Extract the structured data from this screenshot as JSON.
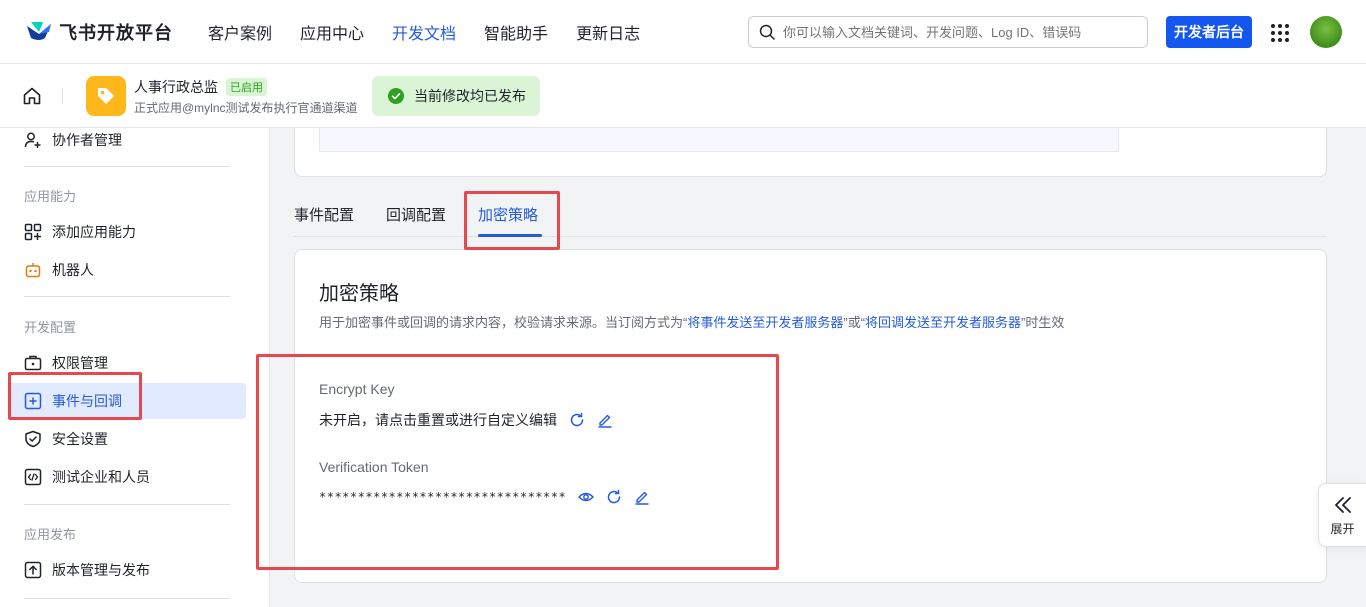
{
  "topnav": {
    "logo_text": "飞书开放平台",
    "items": [
      {
        "label": "客户案例",
        "active": false
      },
      {
        "label": "应用中心",
        "active": false
      },
      {
        "label": "开发文档",
        "active": true
      },
      {
        "label": "智能助手",
        "active": false
      },
      {
        "label": "更新日志",
        "active": false
      }
    ],
    "search_placeholder": "你可以输入文档关键词、开发问题、Log ID、错误码",
    "dev_console_label": "开发者后台"
  },
  "appbar": {
    "app_name": "人事行政总监",
    "app_status": "已启用",
    "app_subtitle": "正式应用@mylnc测试发布执行官通道渠道",
    "publish_status": "当前修改均已发布"
  },
  "sidebar": {
    "collaborators": "协作者管理",
    "groups": [
      {
        "title": "应用能力",
        "items": [
          "添加应用能力",
          "机器人"
        ]
      },
      {
        "title": "开发配置",
        "items": [
          "权限管理",
          "事件与回调",
          "安全设置",
          "测试企业和人员"
        ]
      },
      {
        "title": "应用发布",
        "items": [
          "版本管理与发布"
        ]
      }
    ],
    "active_item": "事件与回调"
  },
  "tabs": [
    {
      "label": "事件配置",
      "active": false
    },
    {
      "label": "回调配置",
      "active": false
    },
    {
      "label": "加密策略",
      "active": true
    }
  ],
  "card": {
    "title": "加密策略",
    "desc_part1": "用于加密事件或回调的请求内容，校验请求来源。当订阅方式为“",
    "desc_link1": "将事件发送至开发者服务器",
    "desc_part2": "”或“",
    "desc_link2": "将回调发送至开发者服务器",
    "desc_part3": "”时生效",
    "encrypt_key_label": "Encrypt Key",
    "encrypt_key_value": "未开启，请点击重置或进行自定义编辑",
    "token_label": "Verification Token",
    "token_value": "********************************"
  },
  "expand_label": "展开",
  "colors": {
    "accent": "#245bdb",
    "primary_button": "#1456f0",
    "highlight_box": "#e5484d",
    "success_bg": "#d9f5d6",
    "success": "#2ea121"
  }
}
